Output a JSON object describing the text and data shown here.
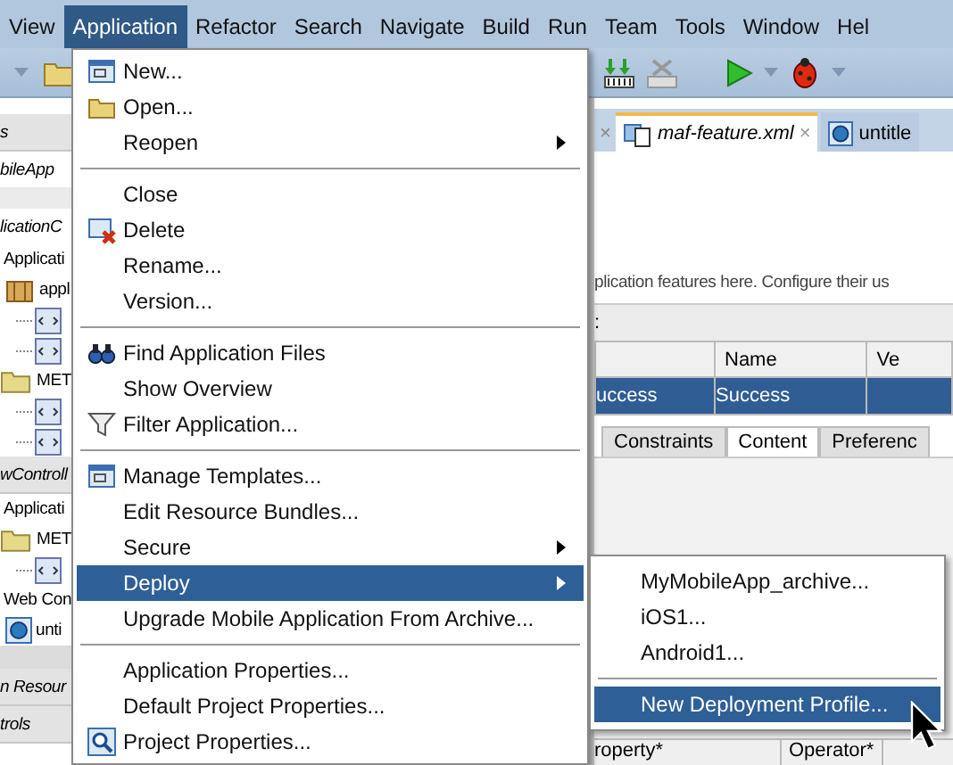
{
  "menubar": [
    {
      "label": "View",
      "selected": false
    },
    {
      "label": "Application",
      "selected": true
    },
    {
      "label": "Refactor",
      "selected": false
    },
    {
      "label": "Search",
      "selected": false
    },
    {
      "label": "Navigate",
      "selected": false
    },
    {
      "label": "Build",
      "selected": false
    },
    {
      "label": "Run",
      "selected": false
    },
    {
      "label": "Team",
      "selected": false
    },
    {
      "label": "Tools",
      "selected": false
    },
    {
      "label": "Window",
      "selected": false
    },
    {
      "label": "Hel",
      "selected": false
    }
  ],
  "navigator": {
    "rows": [
      {
        "kind": "header",
        "label": "s"
      },
      {
        "kind": "title",
        "label": "bileApp"
      },
      {
        "kind": "bar"
      },
      {
        "kind": "title",
        "label": "licationC"
      },
      {
        "kind": "text",
        "label": "Applicati"
      },
      {
        "kind": "package",
        "label": "appl"
      },
      {
        "kind": "leaf"
      },
      {
        "kind": "leaf"
      },
      {
        "kind": "folder",
        "label": "MET"
      },
      {
        "kind": "leaf"
      },
      {
        "kind": "leaf"
      },
      {
        "kind": "header",
        "label": "wControll"
      },
      {
        "kind": "text",
        "label": "Applicati"
      },
      {
        "kind": "folder",
        "label": "MET"
      },
      {
        "kind": "leaf"
      },
      {
        "kind": "text",
        "label": "Web Con"
      },
      {
        "kind": "globe",
        "label": "unti"
      },
      {
        "kind": "bar2"
      },
      {
        "kind": "header",
        "label": "n Resour"
      },
      {
        "kind": "header",
        "label": "trols"
      }
    ]
  },
  "editor": {
    "stray_close": "×",
    "tabs": [
      {
        "label": "maf-feature.xml",
        "selected": true,
        "close": "×"
      },
      {
        "label": "untitle",
        "selected": false
      }
    ],
    "description": "plication features here. Configure their us",
    "section_label": ":",
    "table": {
      "columns": [
        "Name",
        "Ve"
      ],
      "rows": [
        {
          "column_1": "uccess",
          "name": "Success",
          "selected": true
        }
      ]
    },
    "subtabs": [
      {
        "label": "Constraints",
        "selected": false
      },
      {
        "label": "Content",
        "selected": true
      },
      {
        "label": "Preferenc",
        "selected": false
      }
    ],
    "bottom_columns": [
      "roperty*",
      "Operator*"
    ]
  },
  "menu": {
    "items": [
      {
        "kind": "item",
        "label": "New...",
        "submenu": false,
        "selected": false
      },
      {
        "kind": "item",
        "label": "Open...",
        "submenu": false,
        "selected": false
      },
      {
        "kind": "item",
        "label": "Reopen",
        "submenu": true,
        "selected": false
      },
      {
        "kind": "separator"
      },
      {
        "kind": "item",
        "label": "Close",
        "submenu": false,
        "selected": false
      },
      {
        "kind": "item",
        "label": "Delete",
        "submenu": false,
        "selected": false
      },
      {
        "kind": "item",
        "label": "Rename...",
        "submenu": false,
        "selected": false
      },
      {
        "kind": "item",
        "label": "Version...",
        "submenu": false,
        "selected": false
      },
      {
        "kind": "separator"
      },
      {
        "kind": "item",
        "label": "Find Application Files",
        "submenu": false,
        "selected": false
      },
      {
        "kind": "item",
        "label": "Show Overview",
        "submenu": false,
        "selected": false
      },
      {
        "kind": "item",
        "label": "Filter Application...",
        "submenu": false,
        "selected": false
      },
      {
        "kind": "separator"
      },
      {
        "kind": "item",
        "label": "Manage Templates...",
        "submenu": false,
        "selected": false
      },
      {
        "kind": "item",
        "label": "Edit Resource Bundles...",
        "submenu": false,
        "selected": false
      },
      {
        "kind": "item",
        "label": "Secure",
        "submenu": true,
        "selected": false
      },
      {
        "kind": "item",
        "label": "Deploy",
        "submenu": true,
        "selected": true
      },
      {
        "kind": "item",
        "label": "Upgrade Mobile Application From Archive...",
        "submenu": false,
        "selected": false
      },
      {
        "kind": "separator"
      },
      {
        "kind": "item",
        "label": "Application Properties...",
        "submenu": false,
        "selected": false
      },
      {
        "kind": "item",
        "label": "Default Project Properties...",
        "submenu": false,
        "selected": false
      },
      {
        "kind": "item",
        "label": "Project Properties...",
        "submenu": false,
        "selected": false
      }
    ]
  },
  "submenu": {
    "items": [
      {
        "kind": "item",
        "label": "MyMobileApp_archive...",
        "submenu": false,
        "selected": false
      },
      {
        "kind": "item",
        "label": "iOS1...",
        "submenu": false,
        "selected": false
      },
      {
        "kind": "item",
        "label": "Android1...",
        "submenu": false,
        "selected": false
      },
      {
        "kind": "separator"
      },
      {
        "kind": "item",
        "label": "New Deployment Profile...",
        "submenu": false,
        "selected": true
      }
    ]
  }
}
